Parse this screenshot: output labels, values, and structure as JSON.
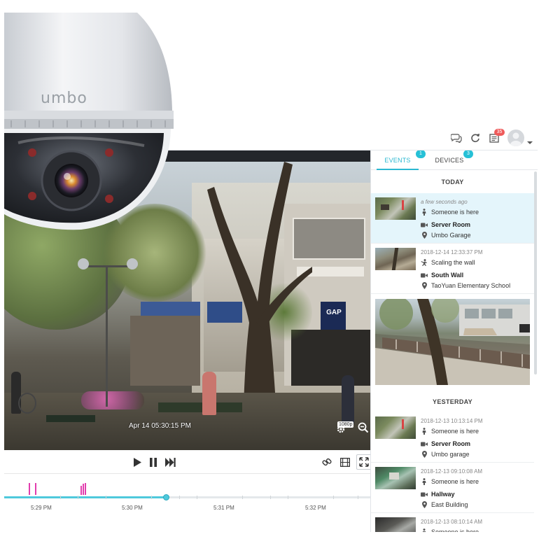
{
  "brand": {
    "camera_logo": "umbo"
  },
  "header": {
    "icons": [
      "chat-icon",
      "refresh-icon",
      "notifications-icon",
      "avatar",
      "chevron-down-icon"
    ],
    "notification_count": "35"
  },
  "video": {
    "timestamp": "Apr 14   05:30:15 PM",
    "quality": "1080p"
  },
  "controls": {
    "icons": [
      "play-icon",
      "pause-icon",
      "fast-forward-icon",
      "link-icon",
      "film-icon",
      "fullscreen-icon"
    ]
  },
  "timeline": {
    "labels": [
      "5:29 PM",
      "5:30 PM",
      "5:31 PM",
      "5:32 PM"
    ],
    "progress_percent": 44,
    "accent_color": "#4fc9dc",
    "event_marker_color": "#e23dae"
  },
  "panel": {
    "tabs": [
      {
        "label": "EVENTS",
        "badge": "1",
        "active": true
      },
      {
        "label": "DEVICES",
        "badge": "3",
        "active": false
      }
    ],
    "sections": {
      "today": "TODAY",
      "yesterday": "YESTERDAY"
    },
    "today_events": [
      {
        "time": "a few seconds ago",
        "type": "Someone is here",
        "camera": "Server Room",
        "location": "Umbo Garage",
        "type_icon": "person-icon"
      },
      {
        "time": "2018-12-14 12:33:37 PM",
        "type": "Scaling the wall",
        "camera": "South Wall",
        "location": "TaoYuan Elementary School",
        "type_icon": "climber-icon"
      }
    ],
    "yesterday_events": [
      {
        "time": "2018-12-13 10:13:14 PM",
        "type": "Someone is here",
        "camera": "Server Room",
        "location": "Umbo garage",
        "type_icon": "person-icon"
      },
      {
        "time": "2018-12-13 09:10:08 AM",
        "type": "Someone is here",
        "camera": "Hallway",
        "location": "East Building",
        "type_icon": "person-icon"
      },
      {
        "time": "2018-12-13 08:10:14 AM",
        "type": "Someone is here",
        "type_icon": "person-icon"
      }
    ],
    "accent_color": "#2bb8d1",
    "active_row_color": "#e4f5fb"
  }
}
